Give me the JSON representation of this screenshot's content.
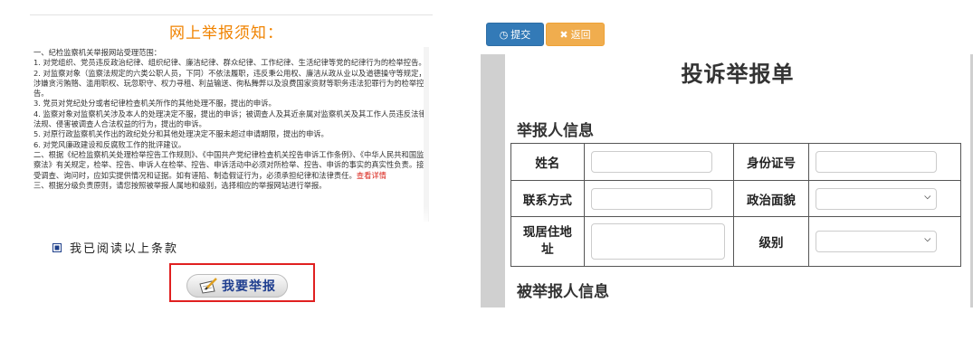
{
  "notice": {
    "title": "网上举报须知：",
    "paragraphs": [
      "一、纪检监察机关举报网站受理范围：",
      "1. 对党组织、党员违反政治纪律、组织纪律、廉洁纪律、群众纪律、工作纪律、生活纪律等党的纪律行为的检举控告。",
      "2. 对监察对象（监察法规定的六类公职人员，下同）不依法履职，违反秉公用权、廉洁从政从业以及道德操守等规定，涉嫌贪污贿赂、滥用职权、玩忽职守、权力寻租、利益输送、徇私舞弊以及浪费国家资财等职务违法犯罪行为的检举控告。",
      "3. 党员对党纪处分或者纪律检查机关所作的其他处理不服，提出的申诉。",
      "4. 监察对象对监察机关涉及本人的处理决定不服，提出的申诉；被调查人及其近亲属对监察机关及其工作人员违反法律法规、侵害被调查人合法权益的行为，提出的申诉。",
      "5. 对原行政监察机关作出的政纪处分和其他处理决定不服未超过申请期限，提出的申诉。",
      "6. 对党风廉政建设和反腐败工作的批评建议。",
      "二、根据《纪检监察机关处理检举控告工作规则》、《中国共产党纪律检查机关控告申诉工作条例》、《中华人民共和国监察法》有关规定，检举、控告、申诉人在检举、控告、申诉活动中必须对所检举、控告、申诉的事实的真实性负责。接受调查、询问时，应如实提供情况和证据。如有诬陷、制造假证行为，必须承担纪律和法律责任。",
      "三、根据分级负责原则，请您按照被举报人属地和级别，选择相应的举报网站进行举报。"
    ],
    "read_more": "查看详情"
  },
  "agree_label": "我已阅读以上条款",
  "report_button_label": "我要举报",
  "toolbar": {
    "submit_label": "提交",
    "back_label": "返回"
  },
  "form": {
    "title": "投诉举报单",
    "section_reporter": "举报人信息",
    "section_reported": "被举报人信息",
    "labels": {
      "name": "姓名",
      "id_number": "身份证号",
      "contact": "联系方式",
      "political_status": "政治面貌",
      "address": "现居住地址",
      "level": "级别"
    }
  },
  "colors": {
    "notice_title": "#f08300",
    "submit": "#337ab7",
    "back": "#f0ad4e",
    "highlight": "#e02020",
    "report_text": "#1f3e8f"
  },
  "icons": {
    "submit": "clock-icon",
    "back": "x-icon",
    "report": "pen-paper-icon",
    "select": "chevron-down-icon"
  }
}
